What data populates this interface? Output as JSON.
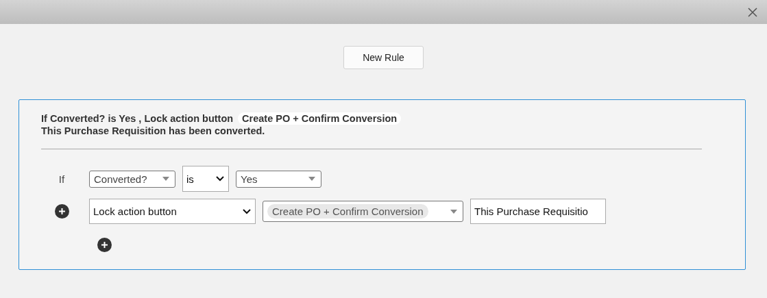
{
  "new_rule_button": "New Rule",
  "summary": {
    "condition_text": "If Converted? is Yes , Lock action button",
    "chip": "Create PO + Confirm Conversion",
    "message": "This Purchase Requisition has been converted."
  },
  "condition": {
    "label": "If",
    "fields": [
      {
        "kind": "combo",
        "value": "Converted?"
      },
      {
        "kind": "select",
        "value": "is"
      },
      {
        "kind": "combo",
        "value": "Yes"
      }
    ]
  },
  "action": {
    "fields": [
      {
        "kind": "select",
        "value": "Lock action button"
      },
      {
        "kind": "tag-combo",
        "value": "Create PO + Confirm Conversion"
      },
      {
        "kind": "text",
        "value": "This Purchase Requisitio"
      }
    ]
  }
}
